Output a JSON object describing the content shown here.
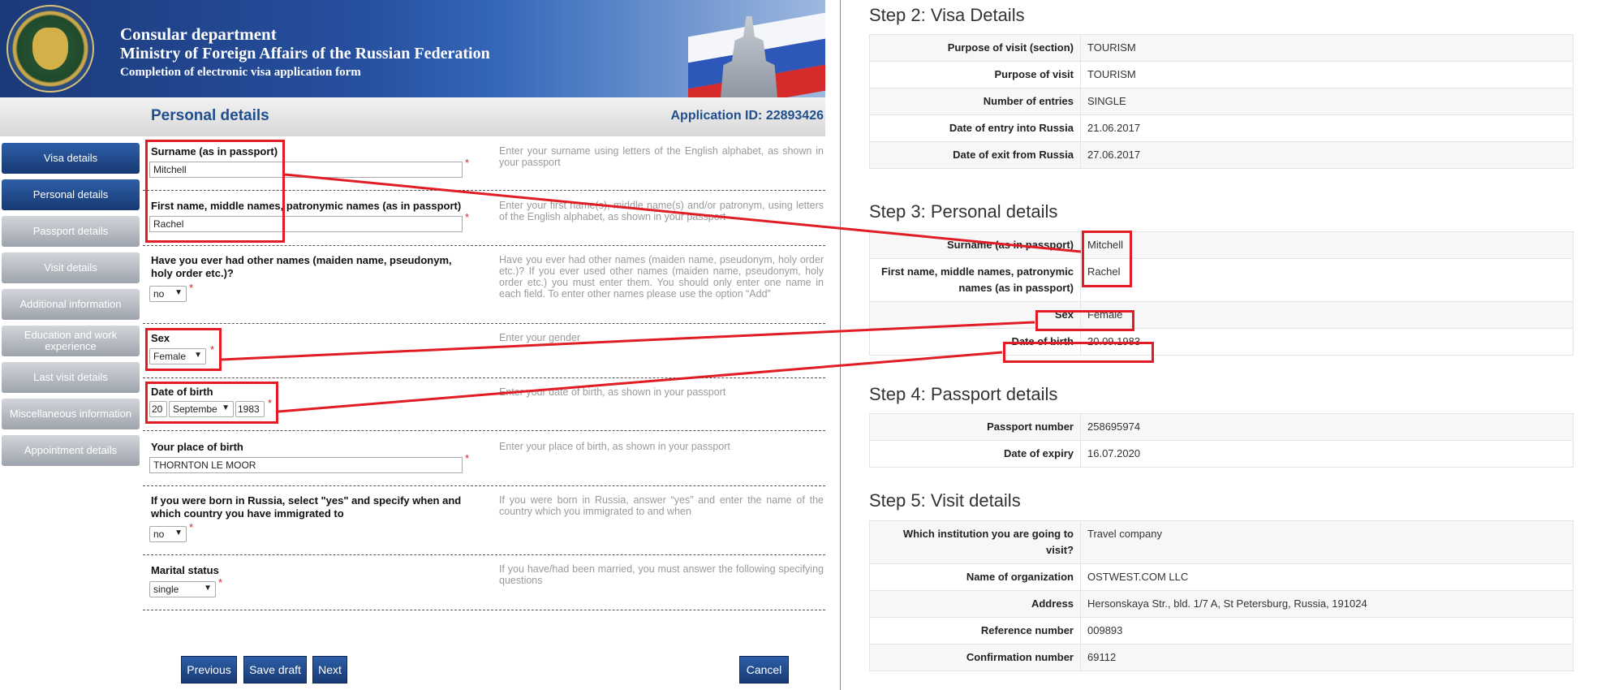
{
  "banner": {
    "line1": "Consular department",
    "line2": "Ministry of Foreign Affairs of the Russian Federation",
    "line3": "Completion of electronic visa application form"
  },
  "header": {
    "title": "Personal details",
    "application_id": "Application ID: 22893426"
  },
  "sidebar": {
    "items": [
      {
        "label": "Visa details"
      },
      {
        "label": "Personal details"
      },
      {
        "label": "Passport details"
      },
      {
        "label": "Visit details"
      },
      {
        "label": "Additional information"
      },
      {
        "label": "Education and work experience"
      },
      {
        "label": "Last visit details"
      },
      {
        "label": "Miscellaneous information"
      },
      {
        "label": "Appointment details"
      }
    ]
  },
  "form": {
    "surname": {
      "label": "Surname (as in passport)",
      "value": "Mitchell",
      "hint": "Enter your surname using letters of the English alphabet, as shown in your passport"
    },
    "first_name": {
      "label": "First name, middle names, patronymic names (as in passport)",
      "value": "Rachel",
      "hint": "Enter your first name(s), middle name(s) and/or patronym, using letters of the English alphabet, as shown in your passport"
    },
    "other_names": {
      "label": "Have you ever had other names (maiden name, pseudonym, holy order etc.)?",
      "value": "no",
      "hint": "Have you ever had other names (maiden name, pseudonym, holy order etc.)? If you ever used other names (maiden name, pseudonym, holy order etc.) you must enter them. You should only enter one name in each field. To enter other names please use the option “Add”"
    },
    "sex": {
      "label": "Sex",
      "value": "Female",
      "hint": "Enter your gender"
    },
    "dob": {
      "label": "Date of birth",
      "day": "20",
      "month": "Septembe",
      "year": "1983",
      "hint": "Enter your date of birth, as shown in your passport"
    },
    "place_of_birth": {
      "label": "Your place of birth",
      "value": "THORNTON LE MOOR",
      "hint": "Enter your place of birth, as shown in your passport"
    },
    "born_in_russia": {
      "label": "If you were born in Russia, select \"yes\" and specify when and which country you have immigrated to",
      "value": "no",
      "hint": "If you were born in Russia, answer “yes” and enter the name of the country which you immigrated to and when"
    },
    "marital": {
      "label": "Marital status",
      "value": "single",
      "hint": "If you have/had been married, you must answer the following specifying questions"
    },
    "required_mark": "*"
  },
  "buttons": {
    "previous": "Previous",
    "save_draft": "Save draft",
    "next": "Next",
    "cancel": "Cancel"
  },
  "summary": {
    "step2": {
      "title": "Step 2: Visa Details",
      "rows": [
        {
          "k": "Purpose of visit (section)",
          "v": "TOURISM"
        },
        {
          "k": "Purpose of visit",
          "v": "TOURISM"
        },
        {
          "k": "Number of entries",
          "v": "SINGLE"
        },
        {
          "k": "Date of entry into Russia",
          "v": "21.06.2017"
        },
        {
          "k": "Date of exit from Russia",
          "v": "27.06.2017"
        }
      ]
    },
    "step3": {
      "title": "Step 3: Personal details",
      "rows": [
        {
          "k": "Surname (as in passport)",
          "v": "Mitchell"
        },
        {
          "k": "First name, middle names, patronymic names (as in passport)",
          "v": "Rachel"
        },
        {
          "k": "Sex",
          "v": "Female"
        },
        {
          "k": "Date of birth",
          "v": "20.09.1983"
        }
      ]
    },
    "step4": {
      "title": "Step 4: Passport details",
      "rows": [
        {
          "k": "Passport number",
          "v": "258695974"
        },
        {
          "k": "Date of expiry",
          "v": "16.07.2020"
        }
      ]
    },
    "step5": {
      "title": "Step 5: Visit details",
      "rows": [
        {
          "k": "Which institution you are going to visit?",
          "v": "Travel company"
        },
        {
          "k": "Name of organization",
          "v": "OSTWEST.COM LLC"
        },
        {
          "k": "Address",
          "v": "Hersonskaya Str., bld. 1/7 A, St Petersburg, Russia, 191024"
        },
        {
          "k": "Reference number",
          "v": "009893"
        },
        {
          "k": "Confirmation number",
          "v": "69112"
        }
      ]
    }
  },
  "colors": {
    "accent_blue": "#1f4e8e",
    "highlight_red": "#e21c24"
  }
}
